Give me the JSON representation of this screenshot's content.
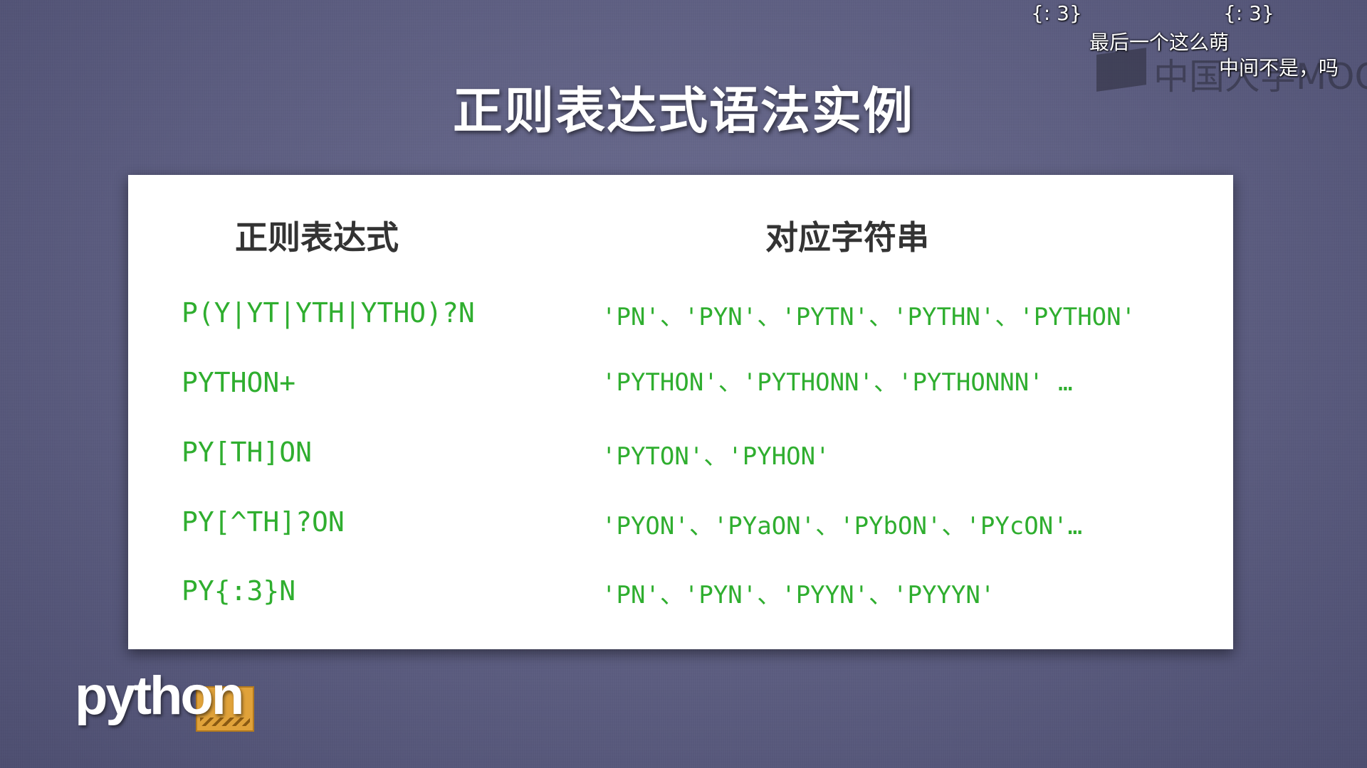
{
  "slide": {
    "title": "正则表达式语法实例"
  },
  "table": {
    "header_regex": "正则表达式",
    "header_strings": "对应字符串",
    "rows": [
      {
        "regex": "P(Y|YT|YTH|YTHO)?N",
        "strings": "'PN'、'PYN'、'PYTN'、'PYTHN'、'PYTHON'"
      },
      {
        "regex": "PYTHON+",
        "strings": "'PYTHON'、'PYTHONN'、'PYTHONNN' …"
      },
      {
        "regex": "PY[TH]ON",
        "strings": "'PYTON'、'PYHON'"
      },
      {
        "regex": "PY[^TH]?ON",
        "strings": "'PYON'、'PYaON'、'PYbON'、'PYcON'…"
      },
      {
        "regex": "PY{:3}N",
        "strings": "'PN'、'PYN'、'PYYN'、'PYYYN'"
      }
    ]
  },
  "logo": {
    "text": "python"
  },
  "watermark": {
    "text": "中国大学MOOC"
  },
  "subtitles": {
    "line1_left": "{: 3}",
    "line1_right": "{: 3}",
    "line2": "最后一个这么萌",
    "line3": "中间不是，吗"
  }
}
